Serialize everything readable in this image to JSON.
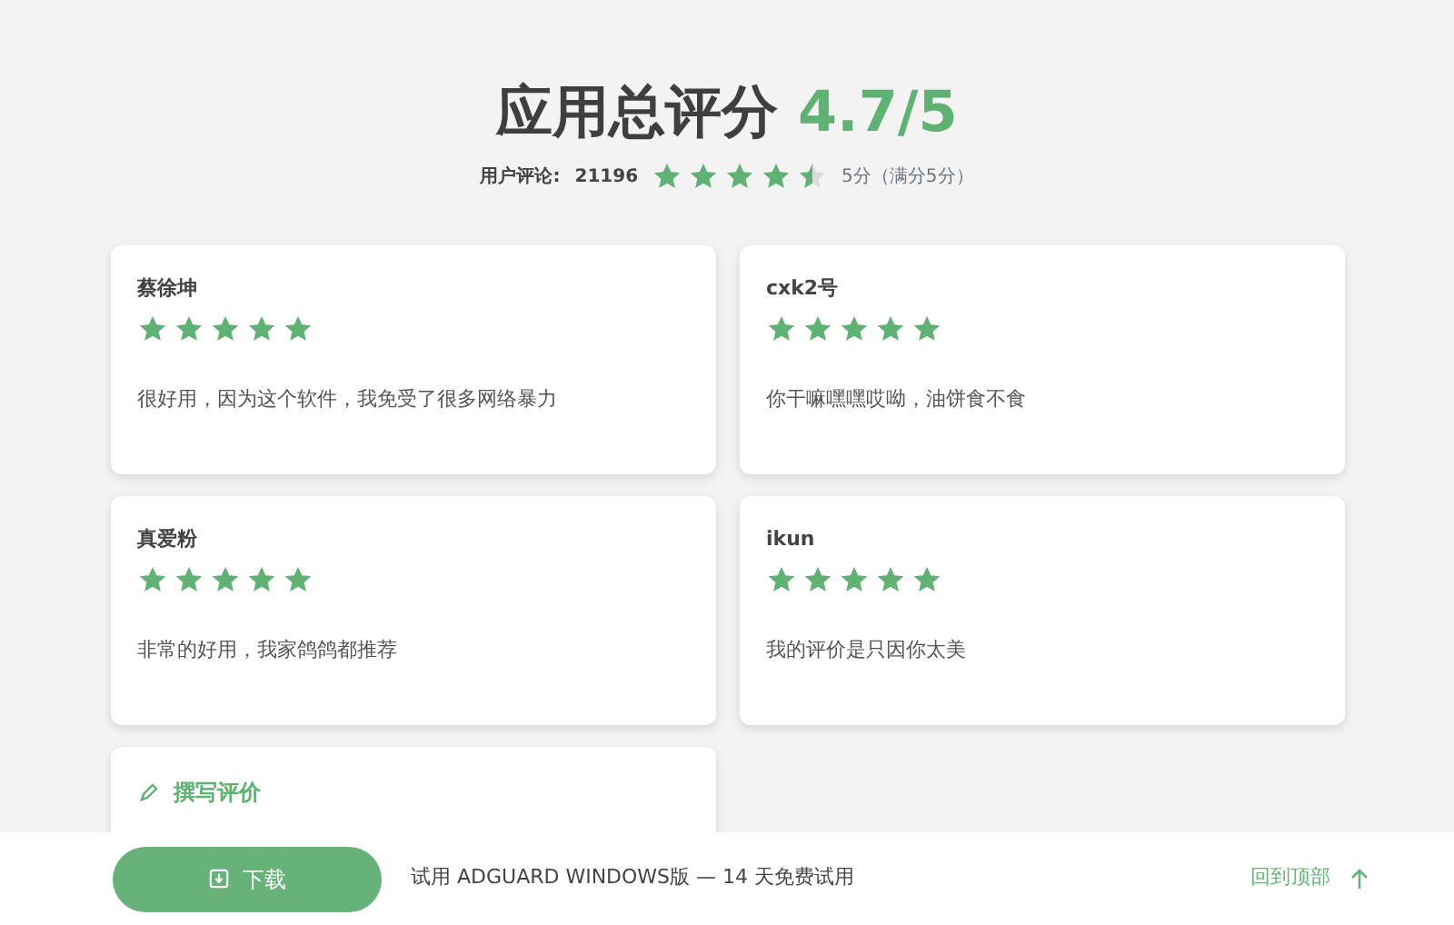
{
  "header": {
    "title": "应用总评分",
    "score": "4.7/5",
    "reviews_label": "用户评论:",
    "reviews_count": "21196",
    "stars": 4.5,
    "score_note": "5分（满分5分）"
  },
  "reviews": [
    {
      "author": "蔡徐坤",
      "stars": 5,
      "text": "很好用，因为这个软件，我免受了很多网络暴力"
    },
    {
      "author": "cxk2号",
      "stars": 5,
      "text": "你干嘛嘿嘿哎呦，油饼食不食"
    },
    {
      "author": "真爱粉",
      "stars": 5,
      "text": "非常的好用，我家鸽鸽都推荐"
    },
    {
      "author": "ikun",
      "stars": 5,
      "text": "我的评价是只因你太美"
    }
  ],
  "write_review": {
    "label": "撰写评价"
  },
  "footer": {
    "download_button": "下载",
    "promo": "试用 ADGUARD WINDOWS版 — 14 天免费试用",
    "back_to_top": "回到顶部"
  }
}
